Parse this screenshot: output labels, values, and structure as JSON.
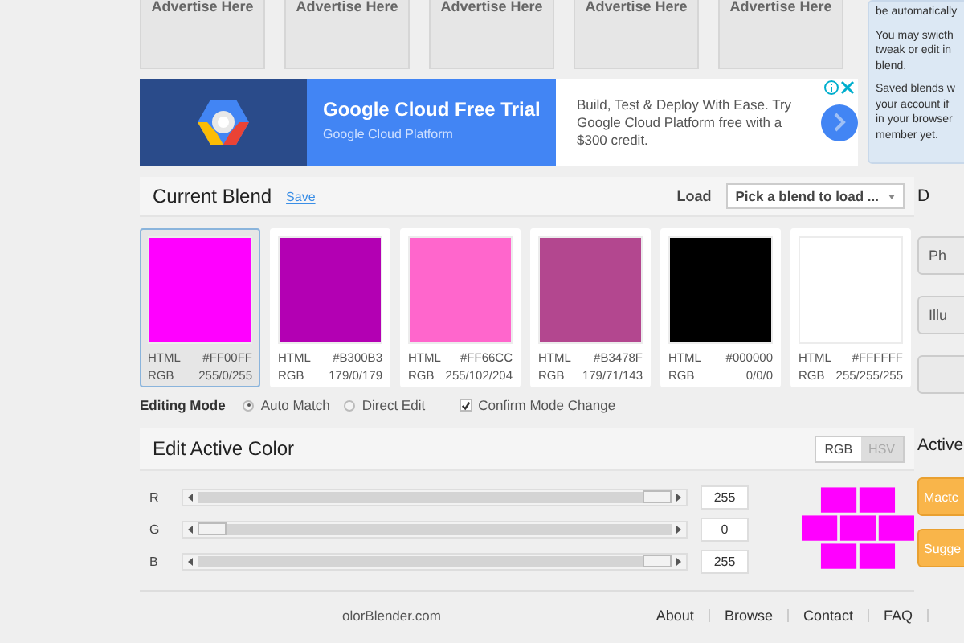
{
  "ad_slots": [
    "Advertise Here",
    "Advertise Here",
    "Advertise Here",
    "Advertise Here",
    "Advertise Here"
  ],
  "banner": {
    "title": "Google Cloud Free Trial",
    "subtitle": "Google Cloud Platform",
    "body": "Build, Test & Deploy With Ease. Try Google Cloud Platform free with a $300 credit."
  },
  "info_panel": {
    "paragraphs": [
      [
        "be automatically"
      ],
      [
        "You may swicth",
        "tweak or edit in",
        "blend."
      ],
      [
        "Saved blends w",
        "your account if",
        "in your browser",
        "member yet."
      ]
    ]
  },
  "current_blend": {
    "title": "Current Blend",
    "save_link": "Save",
    "load_label": "Load",
    "load_select": "Pick a blend to load ...",
    "swatches": [
      {
        "color": "#ff00ff",
        "html_label": "HTML",
        "html": "#FF00FF",
        "rgb_label": "RGB",
        "rgb": "255/0/255",
        "selected": true
      },
      {
        "color": "#b300b3",
        "html_label": "HTML",
        "html": "#B300B3",
        "rgb_label": "RGB",
        "rgb": "179/0/179",
        "selected": false
      },
      {
        "color": "#ff66cc",
        "html_label": "HTML",
        "html": "#FF66CC",
        "rgb_label": "RGB",
        "rgb": "255/102/204",
        "selected": false
      },
      {
        "color": "#b3478f",
        "html_label": "HTML",
        "html": "#B3478F",
        "rgb_label": "RGB",
        "rgb": "179/71/143",
        "selected": false
      },
      {
        "color": "#000000",
        "html_label": "HTML",
        "html": "#000000",
        "rgb_label": "RGB",
        "rgb": "0/0/0",
        "selected": false
      },
      {
        "color": "#ffffff",
        "html_label": "HTML",
        "html": "#FFFFFF",
        "rgb_label": "RGB",
        "rgb": "255/255/255",
        "selected": false
      }
    ]
  },
  "editing_mode": {
    "label": "Editing Mode",
    "options": [
      {
        "label": "Auto Match",
        "selected": true
      },
      {
        "label": "Direct Edit",
        "selected": false
      }
    ],
    "confirm": {
      "label": "Confirm Mode Change",
      "checked": true
    }
  },
  "edit_active_color": {
    "title": "Edit Active Color",
    "tabs": [
      {
        "label": "RGB",
        "selected": true
      },
      {
        "label": "HSV",
        "selected": false
      }
    ],
    "channels": [
      {
        "name": "R",
        "level": 1,
        "value": "255"
      },
      {
        "name": "G",
        "level": 0,
        "value": "0"
      },
      {
        "name": "B",
        "level": 1,
        "value": "255"
      }
    ]
  },
  "side": {
    "heading_1": "D",
    "buttons": [
      "Ph",
      "Illu"
    ],
    "heading_2": "Active",
    "action_buttons": [
      "Mactc",
      "Sugge"
    ]
  },
  "footer": {
    "copyright": "olorBlender.com",
    "links": [
      "About",
      "Browse",
      "Contact",
      "FAQ"
    ]
  }
}
